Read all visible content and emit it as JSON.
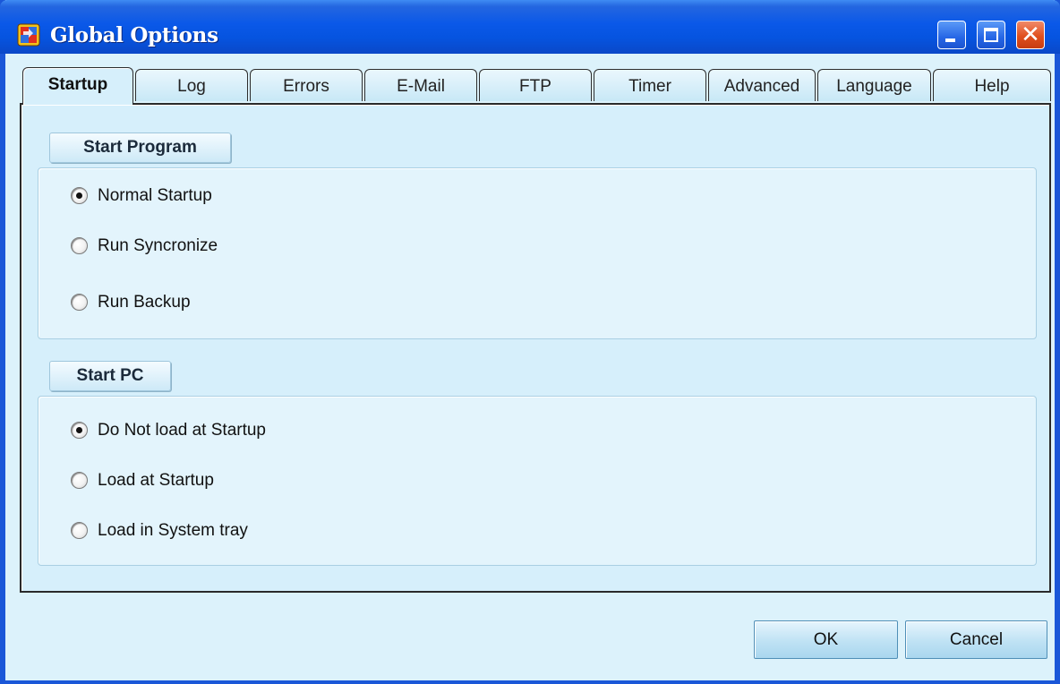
{
  "window": {
    "title": "Global Options",
    "icon": "app-icon",
    "controls": {
      "minimize": "minimize-icon",
      "maximize": "maximize-icon",
      "close": "close-icon"
    }
  },
  "tabs": [
    {
      "label": "Startup",
      "active": true
    },
    {
      "label": "Log"
    },
    {
      "label": "Errors"
    },
    {
      "label": "E-Mail"
    },
    {
      "label": "FTP"
    },
    {
      "label": "Timer"
    },
    {
      "label": "Advanced"
    },
    {
      "label": "Language"
    },
    {
      "label": "Help"
    }
  ],
  "start_program": {
    "title": "Start Program",
    "options": [
      {
        "label": "Normal Startup",
        "checked": true
      },
      {
        "label": "Run Syncronize",
        "checked": false
      },
      {
        "label": "Run Backup",
        "checked": false
      }
    ]
  },
  "start_pc": {
    "title": "Start PC",
    "options": [
      {
        "label": "Do Not load at Startup",
        "checked": true
      },
      {
        "label": "Load at Startup",
        "checked": false
      },
      {
        "label": "Load in System tray",
        "checked": false
      }
    ]
  },
  "buttons": {
    "ok": "OK",
    "cancel": "Cancel"
  },
  "colors": {
    "titlebar": "#0a58e8",
    "panel": "#d6effb",
    "close": "#e0501e"
  }
}
